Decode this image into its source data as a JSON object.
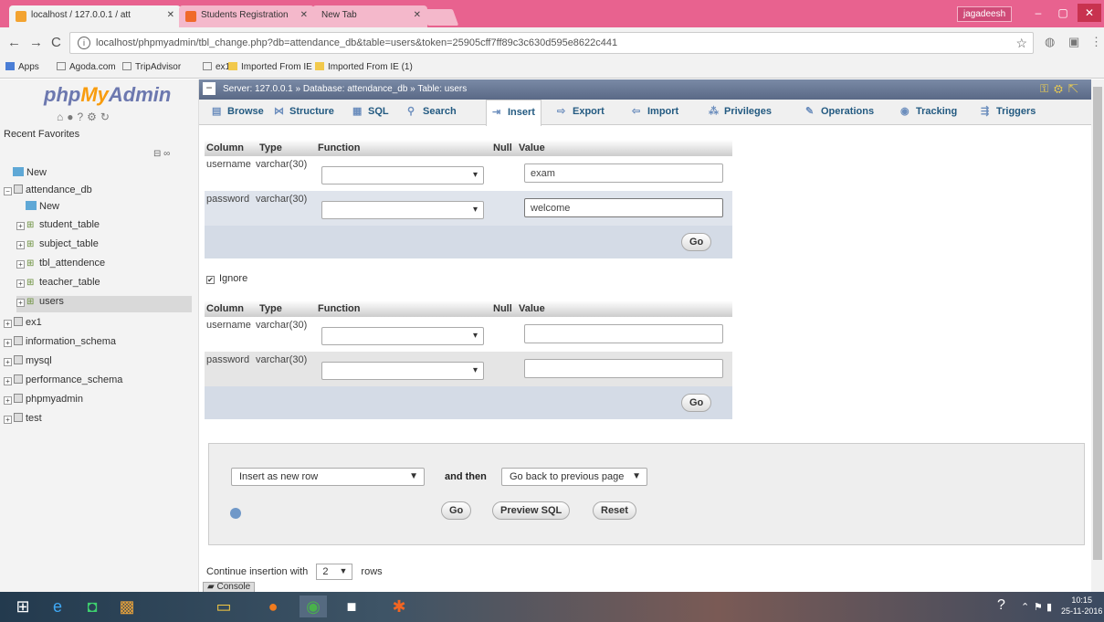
{
  "browser": {
    "tabs": [
      {
        "title": "localhost / 127.0.0.1 / att"
      },
      {
        "title": "Students Registration"
      },
      {
        "title": "New Tab"
      }
    ],
    "user": "jagadeesh",
    "url": "localhost/phpmyadmin/tbl_change.php?db=attendance_db&table=users&token=25905cff7ff89c3c630d595e8622c441",
    "bookmarks": [
      "Apps",
      "Agoda.com",
      "TripAdvisor",
      "ex1",
      "Imported From IE",
      "Imported From IE (1)"
    ]
  },
  "nav": {
    "logo_a": "php",
    "logo_b": "My",
    "logo_c": "Admin",
    "recent_favorites": "Recent  Favorites",
    "items": [
      {
        "label": "New"
      },
      {
        "label": "attendance_db"
      },
      {
        "label": "New"
      },
      {
        "label": "student_table"
      },
      {
        "label": "subject_table"
      },
      {
        "label": "tbl_attendence"
      },
      {
        "label": "teacher_table"
      },
      {
        "label": "users"
      },
      {
        "label": "ex1"
      },
      {
        "label": "information_schema"
      },
      {
        "label": "mysql"
      },
      {
        "label": "performance_schema"
      },
      {
        "label": "phpmyadmin"
      },
      {
        "label": "test"
      }
    ]
  },
  "breadcrumb": {
    "server": "Server: 127.0.0.1",
    "database": "Database: attendance_db",
    "table": "Table: users"
  },
  "tabs": [
    "Browse",
    "Structure",
    "SQL",
    "Search",
    "Insert",
    "Export",
    "Import",
    "Privileges",
    "Operations",
    "Tracking",
    "Triggers"
  ],
  "table_headers": {
    "column": "Column",
    "type": "Type",
    "function": "Function",
    "null": "Null",
    "value": "Value"
  },
  "row_set_1": [
    {
      "column": "username",
      "type": "varchar(30)",
      "value": "exam"
    },
    {
      "column": "password",
      "type": "varchar(30)",
      "value": "welcome"
    }
  ],
  "row_set_2": [
    {
      "column": "username",
      "type": "varchar(30)",
      "value": ""
    },
    {
      "column": "password",
      "type": "varchar(30)",
      "value": ""
    }
  ],
  "go_label": "Go",
  "ignore_label": "Ignore",
  "actions": {
    "insert_mode": "Insert as new row",
    "and_then": "and then",
    "after": "Go back to previous page",
    "go": "Go",
    "preview": "Preview SQL",
    "reset": "Reset"
  },
  "continue": {
    "prefix": "Continue insertion with",
    "count": "2",
    "suffix": "rows"
  },
  "console": "Console",
  "clock": {
    "time": "10:15",
    "date": "25-11-2016"
  }
}
